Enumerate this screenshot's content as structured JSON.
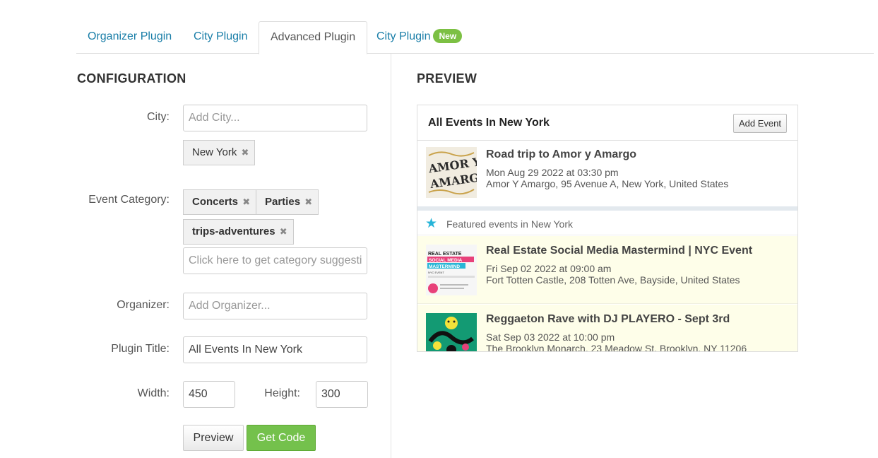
{
  "tabs": [
    {
      "label": "Organizer Plugin",
      "active": false
    },
    {
      "label": "City Plugin",
      "active": false
    },
    {
      "label": "Advanced Plugin",
      "active": true
    },
    {
      "label": "City Plugin",
      "active": false,
      "badge": "New"
    }
  ],
  "config": {
    "title": "CONFIGURATION",
    "city_label": "City:",
    "city_placeholder": "Add City...",
    "city_chips": [
      "New York"
    ],
    "category_label": "Event Category:",
    "category_chips": [
      "Concerts",
      "Parties",
      "trips-adventures"
    ],
    "category_placeholder": "Click here to get category suggestions",
    "organizer_label": "Organizer:",
    "organizer_placeholder": "Add Organizer...",
    "plugin_title_label": "Plugin Title:",
    "plugin_title_value": "All Events In New York",
    "width_label": "Width:",
    "width_value": "450",
    "height_label": "Height:",
    "height_value": "300",
    "preview_button": "Preview",
    "get_code_button": "Get Code",
    "remove_glyph": "✖"
  },
  "preview": {
    "title": "PREVIEW",
    "widget_title": "All Events In New York",
    "add_event_button": "Add Event",
    "featured_label": "Featured events in New York",
    "events": [
      {
        "title": "Road trip to Amor y Amargo",
        "date": "Mon Aug 29 2022 at 03:30 pm",
        "location": "Amor Y Amargo, 95 Avenue A, New York, United States",
        "featured": false,
        "thumb_text": [
          "AMOR Y",
          "AMARGO"
        ]
      },
      {
        "title": "Real Estate Social Media Mastermind | NYC Event",
        "date": "Fri Sep 02 2022 at 09:00 am",
        "location": "Fort Totten Castle, 208 Totten Ave, Bayside, United States",
        "featured": true,
        "thumb_text": [
          "REAL ESTATE",
          "SOCIAL MEDIA",
          "MASTERMIND",
          "NYC EVENT"
        ]
      },
      {
        "title": "Reggaeton Rave with DJ PLAYERO - Sept 3rd",
        "date": "Sat Sep 03 2022 at 10:00 pm",
        "location": "The Brooklyn Monarch, 23 Meadow St, Brooklyn, NY 11206",
        "featured": true
      }
    ]
  },
  "colors": {
    "link": "#1a7ea8",
    "badge_green": "#7cc043",
    "get_code_green": "#74c14c",
    "featured_bg": "#fefee9",
    "star": "#26b4d8"
  }
}
